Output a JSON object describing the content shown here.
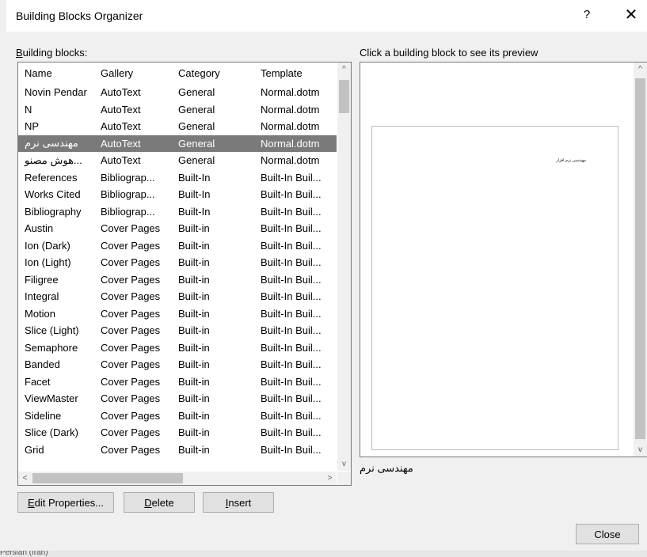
{
  "dialog": {
    "title": "Building Blocks Organizer",
    "help": "?",
    "close_x": "✕"
  },
  "labels": {
    "building_blocks_first": "B",
    "building_blocks_rest": "uilding blocks:",
    "preview_hint": "Click a building block to see its preview"
  },
  "table": {
    "headers": [
      "Name",
      "Gallery",
      "Category",
      "Template"
    ],
    "rows": [
      [
        "Novin Pendar",
        "AutoText",
        "General",
        "Normal.dotm"
      ],
      [
        "N",
        "AutoText",
        "General",
        "Normal.dotm"
      ],
      [
        "NP",
        "AutoText",
        "General",
        "Normal.dotm"
      ],
      [
        "مهندسی نرم",
        "AutoText",
        "General",
        "Normal.dotm"
      ],
      [
        "...هوش مصنو",
        "AutoText",
        "General",
        "Normal.dotm"
      ],
      [
        "References",
        "Bibliograp...",
        "Built-In",
        "Built-In Buil..."
      ],
      [
        "Works Cited",
        "Bibliograp...",
        "Built-In",
        "Built-In Buil..."
      ],
      [
        "Bibliography",
        "Bibliograp...",
        "Built-In",
        "Built-In Buil..."
      ],
      [
        "Austin",
        "Cover Pages",
        "Built-in",
        "Built-In Buil..."
      ],
      [
        "Ion (Dark)",
        "Cover Pages",
        "Built-in",
        "Built-In Buil..."
      ],
      [
        "Ion (Light)",
        "Cover Pages",
        "Built-in",
        "Built-In Buil..."
      ],
      [
        "Filigree",
        "Cover Pages",
        "Built-in",
        "Built-In Buil..."
      ],
      [
        "Integral",
        "Cover Pages",
        "Built-in",
        "Built-In Buil..."
      ],
      [
        "Motion",
        "Cover Pages",
        "Built-in",
        "Built-In Buil..."
      ],
      [
        "Slice (Light)",
        "Cover Pages",
        "Built-in",
        "Built-In Buil..."
      ],
      [
        "Semaphore",
        "Cover Pages",
        "Built-in",
        "Built-In Buil..."
      ],
      [
        "Banded",
        "Cover Pages",
        "Built-in",
        "Built-In Buil..."
      ],
      [
        "Facet",
        "Cover Pages",
        "Built-in",
        "Built-In Buil..."
      ],
      [
        "ViewMaster",
        "Cover Pages",
        "Built-in",
        "Built-In Buil..."
      ],
      [
        "Sideline",
        "Cover Pages",
        "Built-in",
        "Built-In Buil..."
      ],
      [
        "Slice (Dark)",
        "Cover Pages",
        "Built-in",
        "Built-In Buil..."
      ],
      [
        "Grid",
        "Cover Pages",
        "Built-in",
        "Built-In Buil..."
      ]
    ],
    "selected_index": 3
  },
  "buttons": {
    "edit_first": "E",
    "edit_rest": "dit Properties...",
    "delete_first": "D",
    "delete_rest": "elete",
    "insert_first": "I",
    "insert_rest": "nsert",
    "close": "Close"
  },
  "preview": {
    "page_text": "مهندسی نرم افزار",
    "block_name": "مهندسی نرم"
  },
  "statusbar": {
    "text": "Persian (Iran)"
  },
  "icons": {
    "up": "^",
    "down": "v",
    "left": "<",
    "right": ">"
  },
  "colors": {
    "selection": "#7a7a7a",
    "scroll_thumb": "#c2c2c2"
  }
}
